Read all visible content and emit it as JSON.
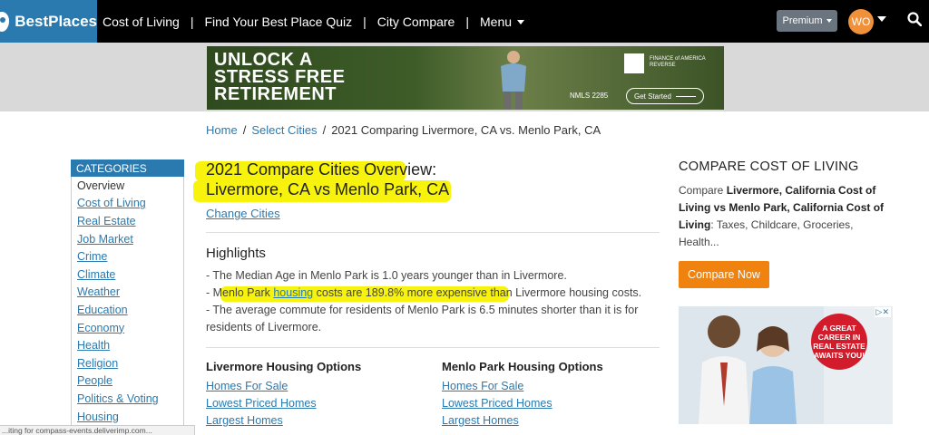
{
  "nav": {
    "brand": "BestPlaces",
    "links": [
      "Cost of Living",
      "Find Your Best Place Quiz",
      "City Compare",
      "Menu"
    ],
    "premium": "Premium",
    "avatar": "WO"
  },
  "banner": {
    "headline_1": "UNLOCK A",
    "headline_2": "STRESS FREE",
    "headline_3": "RETIREMENT",
    "brand_1": "FINANCE of AMERICA",
    "brand_2": "REVERSE",
    "nmls": "NMLS 2285",
    "cta": "Get Started"
  },
  "breadcrumb": {
    "home": "Home",
    "select": "Select Cities",
    "current": "2021 Comparing Livermore, CA vs. Menlo Park, CA"
  },
  "sidebar": {
    "header": "CATEGORIES",
    "items": [
      "Overview",
      "Cost of Living",
      "Real Estate",
      "Job Market",
      "Crime",
      "Climate",
      "Weather",
      "Education",
      "Economy",
      "Health",
      "Religion",
      "People",
      "Politics & Voting",
      "Housing"
    ]
  },
  "main": {
    "title_line1": "2021 Compare Cities Overview:",
    "title_line2": "Livermore, CA vs Menlo Park, CA",
    "change_cities": "Change Cities",
    "highlights_title": "Highlights",
    "hl1": "- The Median Age in Menlo Park is 1.0 years younger than in Livermore.",
    "hl2_pre": "- Menlo Park ",
    "hl2_link": "housing",
    "hl2_post": " costs are 189.8% more expensive than Livermore housing costs.",
    "hl3_a": "- The average commute for residents of Menlo Park is 6.5 minutes shorter than it is for",
    "hl3_b": "residents of Livermore.",
    "left_housing_title": "Livermore Housing Options",
    "left_housing_links": [
      "Homes For Sale",
      "Lowest Priced Homes",
      "Largest Homes"
    ],
    "right_housing_title": "Menlo Park Housing Options",
    "right_housing_links": [
      "Homes For Sale",
      "Lowest Priced Homes",
      "Largest Homes"
    ]
  },
  "right": {
    "title": "COMPARE COST OF LIVING",
    "text_pre": "Compare ",
    "text_bold1": "Livermore, California Cost of Living vs Menlo Park, California Cost of Living",
    "text_post": ": Taxes, Childcare, Groceries, Health...",
    "cta": "Compare Now",
    "ad_badge": "A GREAT CAREER IN REAL ESTATE AWAITS YOU!",
    "ad_close": "▷✕"
  },
  "status": "...iting for compass-events.deliverimp.com..."
}
